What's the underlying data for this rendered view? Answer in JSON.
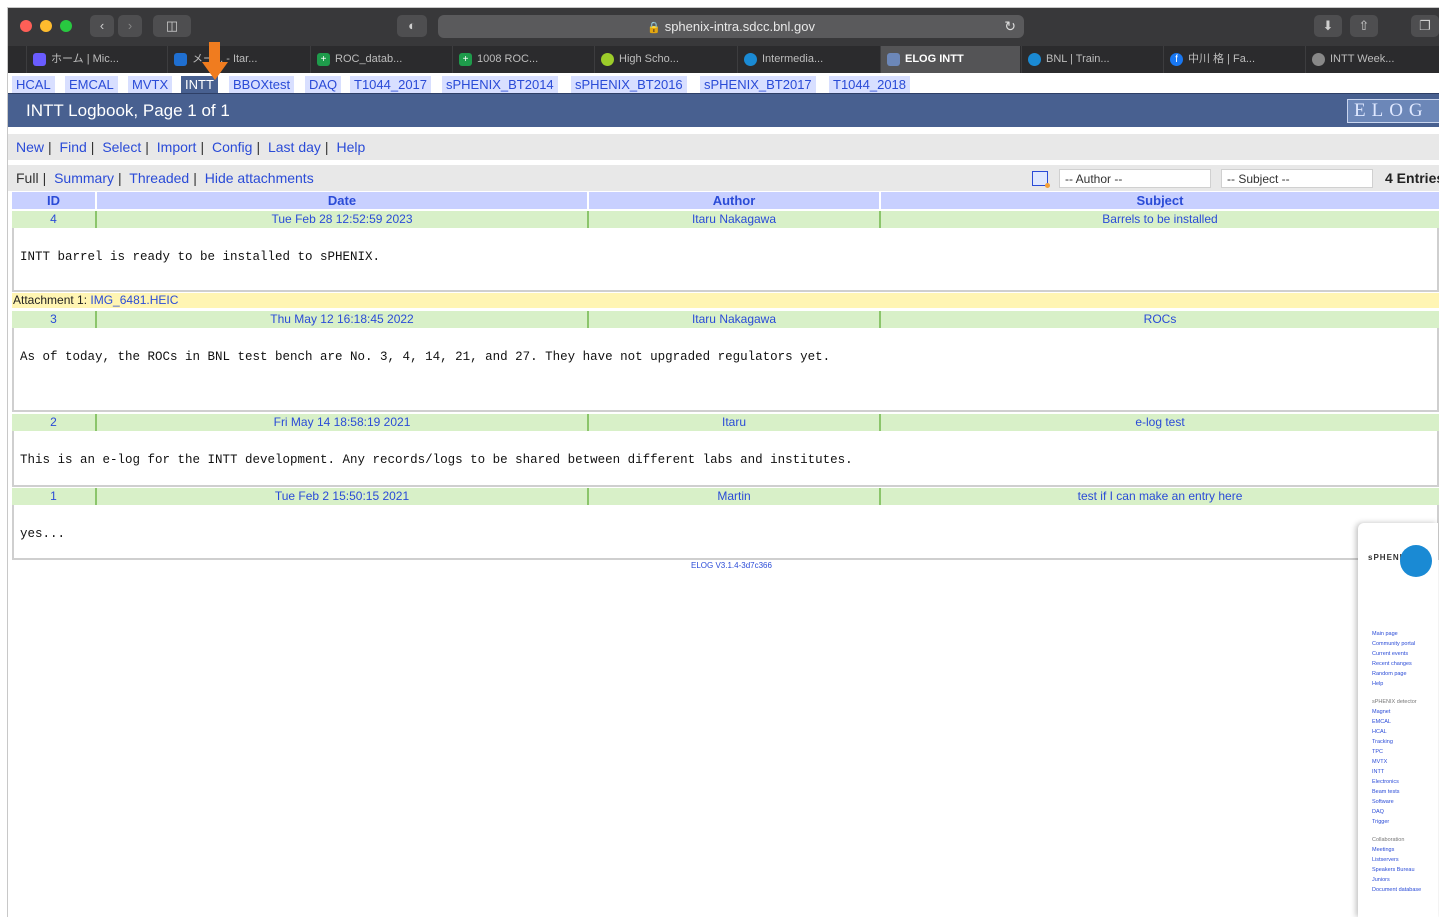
{
  "browser": {
    "url": "sphenix-intra.sdcc.bnl.gov",
    "tabs": [
      {
        "label": "ホーム | Mic...",
        "icon": "messenger-icon",
        "color": "#6a5cff"
      },
      {
        "label": "メー... - Itar...",
        "icon": "outlook-icon",
        "color": "#1f6fd1"
      },
      {
        "label": "ROC_datab...",
        "icon": "sheets-icon",
        "color": "#1e9b4b"
      },
      {
        "label": "1008 ROC...",
        "icon": "sheets-icon",
        "color": "#1e9b4b"
      },
      {
        "label": "High Scho...",
        "icon": "ball-icon",
        "color": "#9ccc2a"
      },
      {
        "label": "Intermedia...",
        "icon": "bnl-icon",
        "color": "#1a8ad4"
      },
      {
        "label": "ELOG INTT",
        "icon": "elog-icon",
        "color": "#6c87b8"
      },
      {
        "label": "BNL | Train...",
        "icon": "bnl-icon",
        "color": "#1a8ad4"
      },
      {
        "label": "中川 格 | Fa...",
        "icon": "facebook-icon",
        "color": "#1877f2"
      },
      {
        "label": "INTT Week...",
        "icon": "meeting-icon",
        "color": "#888888"
      }
    ]
  },
  "logbooks": [
    "HCAL",
    "EMCAL",
    "MVTX",
    "INTT",
    "BBOXtest",
    "DAQ",
    "T1044_2017",
    "sPHENIX_BT2014",
    "sPHENIX_BT2016",
    "sPHENIX_BT2017",
    "T1044_2018"
  ],
  "header": {
    "title": "INTT Logbook, Page 1 of 1",
    "logo": "ELOG"
  },
  "menu": {
    "items": [
      "New",
      "Find",
      "Select",
      "Import",
      "Config",
      "Last day",
      "Help"
    ]
  },
  "views": {
    "current": "Full",
    "links": [
      "Summary",
      "Threaded",
      "Hide attachments"
    ]
  },
  "filters": {
    "author": "-- Author --",
    "subject": "-- Subject --",
    "entries": "4 Entries"
  },
  "table": {
    "columns": [
      "ID",
      "Date",
      "Author",
      "Subject"
    ],
    "entries": [
      {
        "id": "4",
        "date": "Tue Feb 28 12:52:59 2023",
        "author": "Itaru Nakagawa",
        "subject": "Barrels to be installed",
        "text": "INTT barrel is ready to be installed to sPHENIX.",
        "attachment_label": "Attachment 1:",
        "attachment": "IMG_6481.HEIC"
      },
      {
        "id": "3",
        "date": "Thu May 12 16:18:45 2022",
        "author": "Itaru Nakagawa",
        "subject": "ROCs",
        "text": "As of today, the ROCs in BNL test bench are No. 3, 4, 14, 21, and 27. They have not upgraded regulators yet."
      },
      {
        "id": "2",
        "date": "Fri May 14 18:58:19 2021",
        "author": "Itaru",
        "subject": "e-log test",
        "text": "This is an e-log for the INTT development. Any records/logs to be shared between different labs and institutes."
      },
      {
        "id": "1",
        "date": "Tue Feb 2 15:50:15 2021",
        "author": "Martin",
        "subject": "test if I can make an entry here",
        "text": "yes..."
      }
    ]
  },
  "footer": "ELOG V3.1.4-3d7c366",
  "preview": {
    "logo": "sPHENIX",
    "links": [
      "Main page",
      "Community portal",
      "Current events",
      "Recent changes",
      "Random page",
      "Help"
    ],
    "group1": "sPHENIX detector",
    "links2": [
      "Magnet",
      "EMCAL",
      "HCAL",
      "Tracking",
      "TPC",
      "MVTX",
      "INTT",
      "Electronics",
      "Beam tests",
      "Software",
      "DAQ",
      "Trigger"
    ],
    "group2": "Collaboration",
    "links3": [
      "Meetings",
      "Listservers",
      "Speakers Bureau",
      "Juniors",
      "Document database"
    ]
  }
}
